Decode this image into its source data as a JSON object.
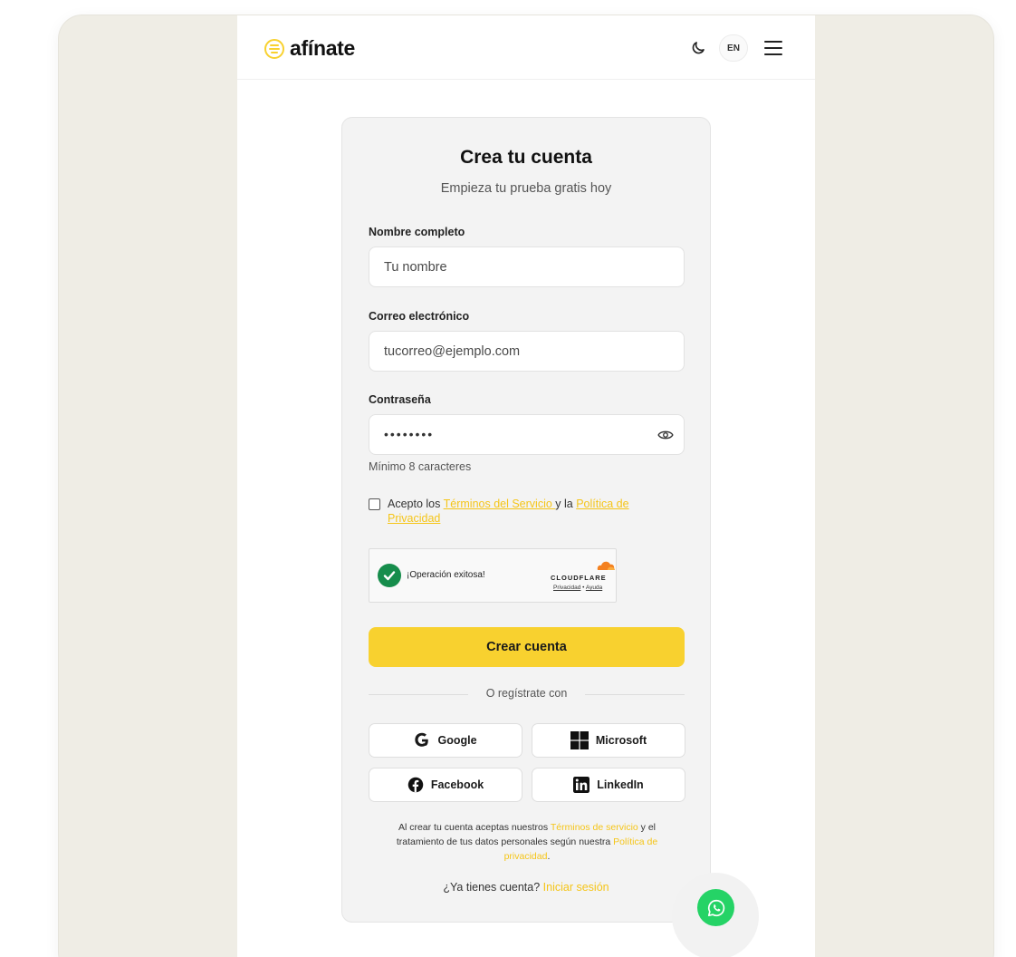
{
  "header": {
    "brand": "afínate",
    "language_button": "EN"
  },
  "form": {
    "title": "Crea tu cuenta",
    "subtitle": "Empieza tu prueba gratis hoy",
    "name_label": "Nombre completo",
    "name_placeholder": "Tu nombre",
    "email_label": "Correo electrónico",
    "email_placeholder": "tucorreo@ejemplo.com",
    "password_label": "Contraseña",
    "password_value": "••••••••",
    "password_hint": "Mínimo 8 caracteres",
    "terms_prefix": "Acepto los ",
    "terms_link": "Términos del Servicio ",
    "terms_middle": "y la ",
    "privacy_link": "Política de Privacidad",
    "captcha_status": "¡Operación exitosa!",
    "captcha_brand": "CLOUDFLARE",
    "captcha_privacy": "Privacidad",
    "captcha_separator": " • ",
    "captcha_help": "Ayuda",
    "submit_label": "Crear cuenta",
    "divider_text": "O regístrate con",
    "social": {
      "google": "Google",
      "microsoft": "Microsoft",
      "facebook": "Facebook",
      "linkedin": "LinkedIn"
    },
    "legal_prefix": "Al crear tu cuenta aceptas nuestros ",
    "legal_terms_link": "Términos de servicio",
    "legal_middle": " y el tratamiento de tus datos personales según nuestra ",
    "legal_privacy_link": "Política de privacidad",
    "legal_suffix": ".",
    "signin_prompt": "¿Ya tienes cuenta? ",
    "signin_link": "Iniciar sesión"
  },
  "colors": {
    "accent": "#f8d12f",
    "link": "#f5c518",
    "whatsapp": "#25d366",
    "captcha_success": "#168d4c"
  },
  "icons": [
    "logo-icon",
    "moon-icon",
    "menu-icon",
    "eye-icon",
    "checkmark-icon",
    "cloudflare-icon",
    "google-icon",
    "microsoft-icon",
    "facebook-icon",
    "linkedin-icon",
    "whatsapp-icon"
  ]
}
